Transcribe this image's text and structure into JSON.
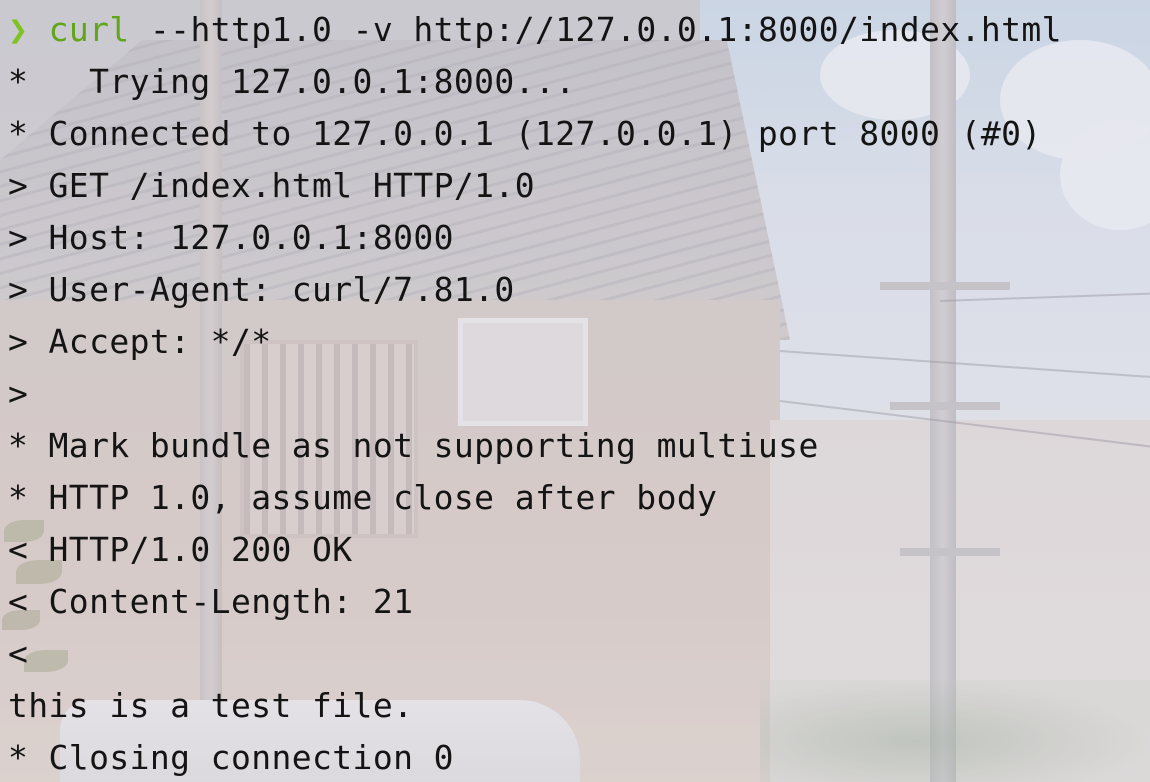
{
  "terminal": {
    "prompt_symbol": "❯",
    "command": {
      "program": "curl",
      "args": " --http1.0 -v http://127.0.0.1:8000/index.html"
    },
    "lines": [
      "*   Trying 127.0.0.1:8000...",
      "* Connected to 127.0.0.1 (127.0.0.1) port 8000 (#0)",
      "> GET /index.html HTTP/1.0",
      "> Host: 127.0.0.1:8000",
      "> User-Agent: curl/7.81.0",
      "> Accept: */*",
      ">",
      "* Mark bundle as not supporting multiuse",
      "* HTTP 1.0, assume close after body",
      "< HTTP/1.0 200 OK",
      "< Content-Length: 21",
      "<",
      "this is a test file.",
      "* Closing connection 0"
    ]
  },
  "colors": {
    "prompt_symbol": "#7ec322",
    "command_program": "#5fa61a",
    "text": "#141414"
  }
}
